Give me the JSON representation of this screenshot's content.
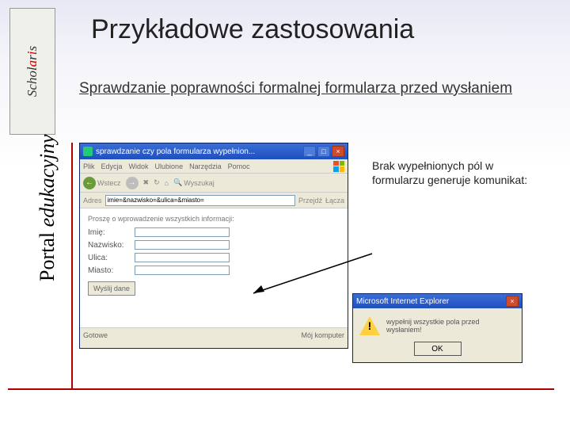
{
  "logo": "Scholaris",
  "sidebar": {
    "word1": "Portal ",
    "word2": "edukacyjny"
  },
  "title": "Przykładowe zastosowania",
  "subtitle": "Sprawdzanie poprawności formalnej formularza przed wysłaniem",
  "description": "Brak wypełnionych pól w formularzu generuje komunikat:",
  "browser": {
    "window_title": "sprawdzanie czy pola formularza wypełnion...",
    "menu": [
      "Plik",
      "Edycja",
      "Widok",
      "Ulubione",
      "Narzędzia",
      "Pomoc"
    ],
    "toolbar": {
      "back": "Wstecz",
      "search": "Wyszukaj"
    },
    "address_label": "Adres",
    "address_value": "imie=&nazwisko=&ulica=&miasto=",
    "go": "Przejdź",
    "links": "Łącza",
    "form_prompt": "Proszę o wprowadzenie wszystkich informacji:",
    "fields": {
      "imie": "Imię:",
      "nazwisko": "Nazwisko:",
      "ulica": "Ulica:",
      "miasto": "Miasto:"
    },
    "submit": "Wyślij dane",
    "status_left": "Gotowe",
    "status_right": "Mój komputer"
  },
  "alert": {
    "title": "Microsoft Internet Explorer",
    "message": "wypełnij wszystkie pola przed wysłaniem!",
    "ok": "OK"
  }
}
